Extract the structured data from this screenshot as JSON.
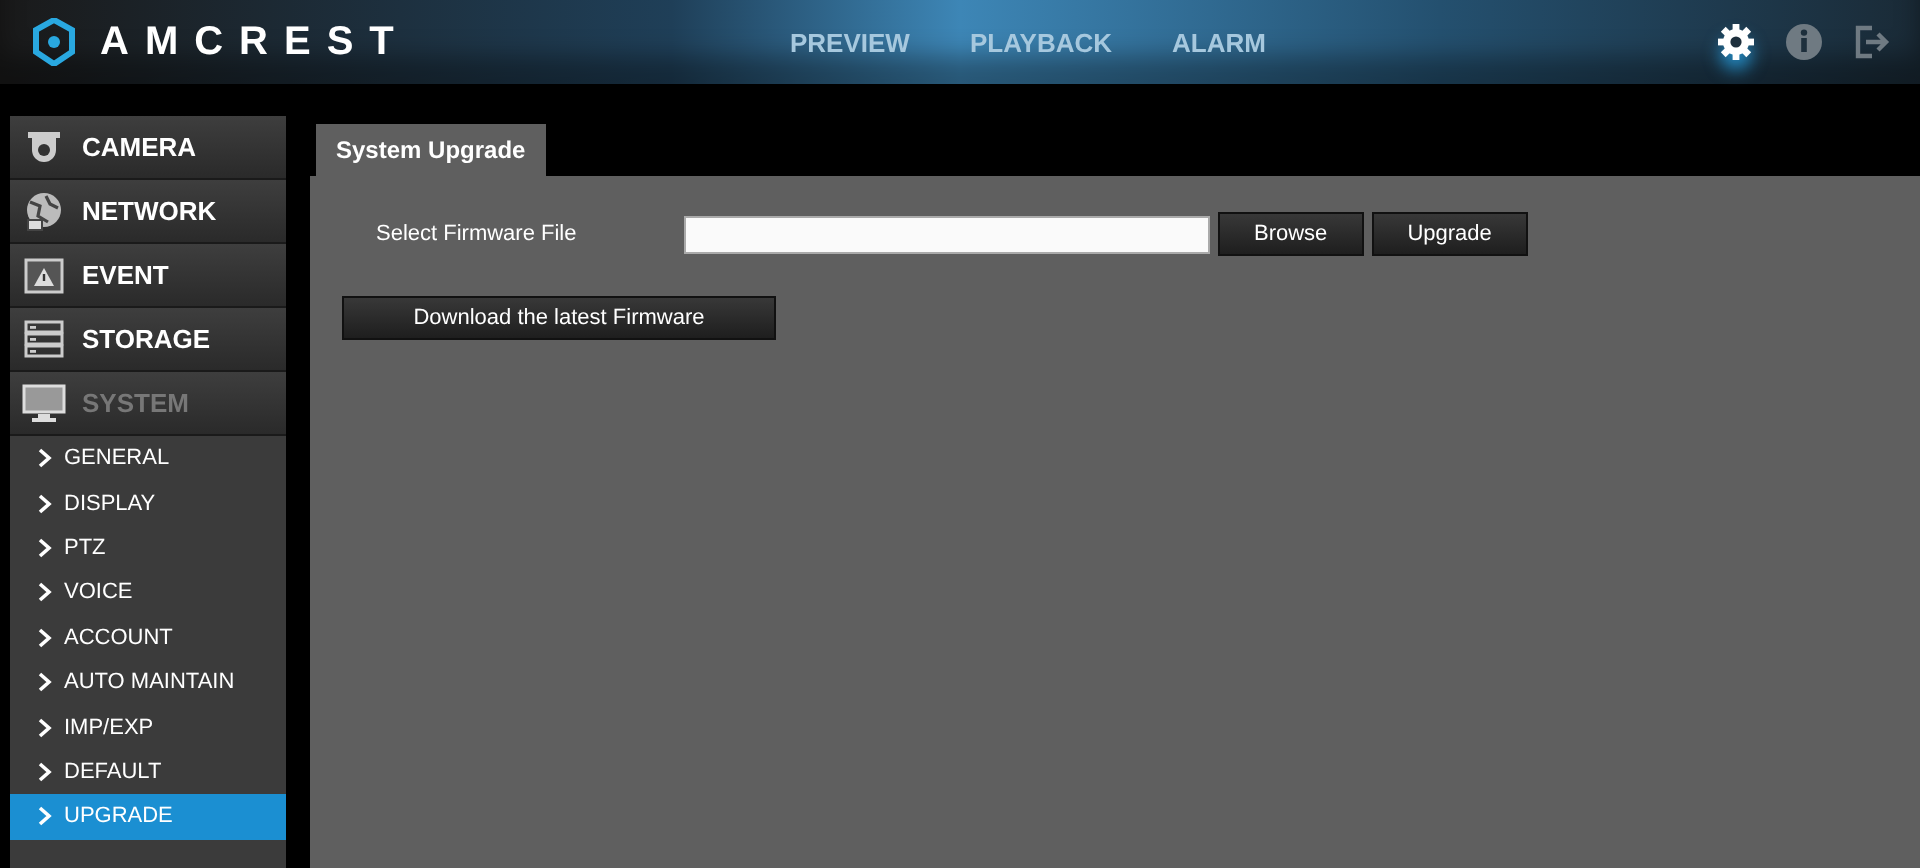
{
  "header": {
    "brand": "AMCREST",
    "nav": [
      {
        "label": "PREVIEW",
        "selected": false
      },
      {
        "label": "PLAYBACK",
        "selected": false
      },
      {
        "label": "ALARM",
        "selected": false
      }
    ],
    "tools": [
      {
        "kind": "settings",
        "selected": true
      },
      {
        "kind": "info",
        "selected": false
      },
      {
        "kind": "logout",
        "selected": false
      }
    ]
  },
  "sidebar": {
    "items": [
      {
        "label": "CAMERA",
        "kind": "camera",
        "selected": false
      },
      {
        "label": "NETWORK",
        "kind": "network",
        "selected": false
      },
      {
        "label": "EVENT",
        "kind": "event",
        "selected": false
      },
      {
        "label": "STORAGE",
        "kind": "storage",
        "selected": false
      },
      {
        "label": "SYSTEM",
        "kind": "system",
        "selected": true,
        "children": [
          {
            "label": "GENERAL",
            "selected": false
          },
          {
            "label": "DISPLAY",
            "selected": false
          },
          {
            "label": "PTZ",
            "selected": false
          },
          {
            "label": "VOICE",
            "selected": false
          },
          {
            "label": "ACCOUNT",
            "selected": false
          },
          {
            "label": "AUTO MAINTAIN",
            "selected": false
          },
          {
            "label": "IMP/EXP",
            "selected": false
          },
          {
            "label": "DEFAULT",
            "selected": false
          },
          {
            "label": "UPGRADE",
            "selected": true
          }
        ]
      }
    ]
  },
  "main": {
    "tabs": [
      {
        "label": "System Upgrade",
        "selected": true
      }
    ],
    "file_label": "Select Firmware File",
    "browse_button": "Browse",
    "upgrade_button": "Upgrade",
    "download_button": "Download the latest Firmware"
  }
}
